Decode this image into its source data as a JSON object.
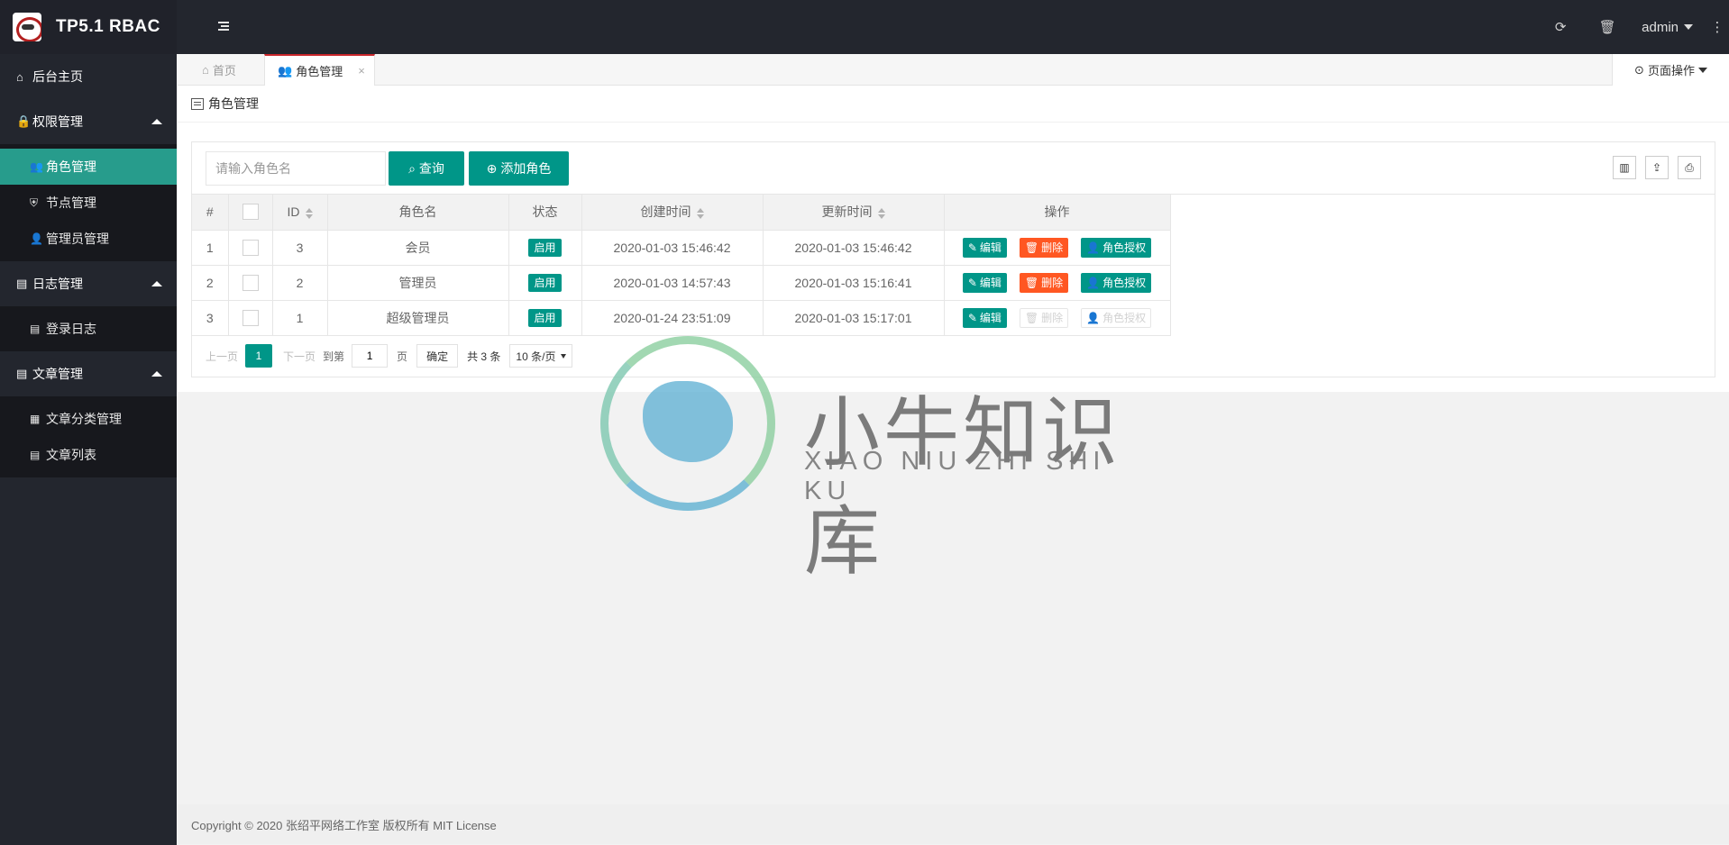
{
  "header": {
    "app_title": "TP5.1 RBAC",
    "user": "admin",
    "icons": [
      "menu-toggle-icon",
      "refresh-icon",
      "trash-icon",
      "more-icon"
    ]
  },
  "sidebar": {
    "home": "后台主页",
    "groups": [
      {
        "label": "权限管理",
        "items": [
          "角色管理",
          "节点管理",
          "管理员管理"
        ]
      },
      {
        "label": "日志管理",
        "items": [
          "登录日志"
        ]
      },
      {
        "label": "文章管理",
        "items": [
          "文章分类管理",
          "文章列表"
        ]
      }
    ]
  },
  "tabs": {
    "home": "首页",
    "active": "角色管理",
    "close": "×",
    "page_ops": "页面操作"
  },
  "card": {
    "title": "角色管理"
  },
  "toolbar": {
    "search_placeholder": "请输入角色名",
    "search_label": "查询",
    "add_label": "添加角色"
  },
  "table": {
    "headers": [
      "#",
      "",
      "ID",
      "角色名",
      "状态",
      "创建时间",
      "更新时间",
      "操作"
    ],
    "rows": [
      {
        "n": "1",
        "id": "3",
        "name": "会员",
        "status": "启用",
        "created": "2020-01-03 15:46:42",
        "updated": "2020-01-03 15:46:42",
        "disabled": false
      },
      {
        "n": "2",
        "id": "2",
        "name": "管理员",
        "status": "启用",
        "created": "2020-01-03 14:57:43",
        "updated": "2020-01-03 15:16:41",
        "disabled": false
      },
      {
        "n": "3",
        "id": "1",
        "name": "超级管理员",
        "status": "启用",
        "created": "2020-01-24 23:51:09",
        "updated": "2020-01-03 15:17:01",
        "disabled": true
      }
    ],
    "ops": {
      "edit": "编辑",
      "delete": "删除",
      "auth": "角色授权"
    }
  },
  "pager": {
    "prev": "上一页",
    "current": "1",
    "next": "下一页",
    "goto": "到第",
    "page_value": "1",
    "page_unit": "页",
    "confirm": "确定",
    "total": "共 3 条",
    "per_page": "10 条/页"
  },
  "watermark": {
    "cn": "小牛知识库",
    "en": "XIAO NIU ZHI SHI KU"
  },
  "footer": "Copyright © 2020 张绍平网络工作室 版权所有 MIT License",
  "colors": {
    "primary": "#009688",
    "danger": "#ff5722",
    "sidebar": "#23262e",
    "active_tab": "#c9262b"
  }
}
